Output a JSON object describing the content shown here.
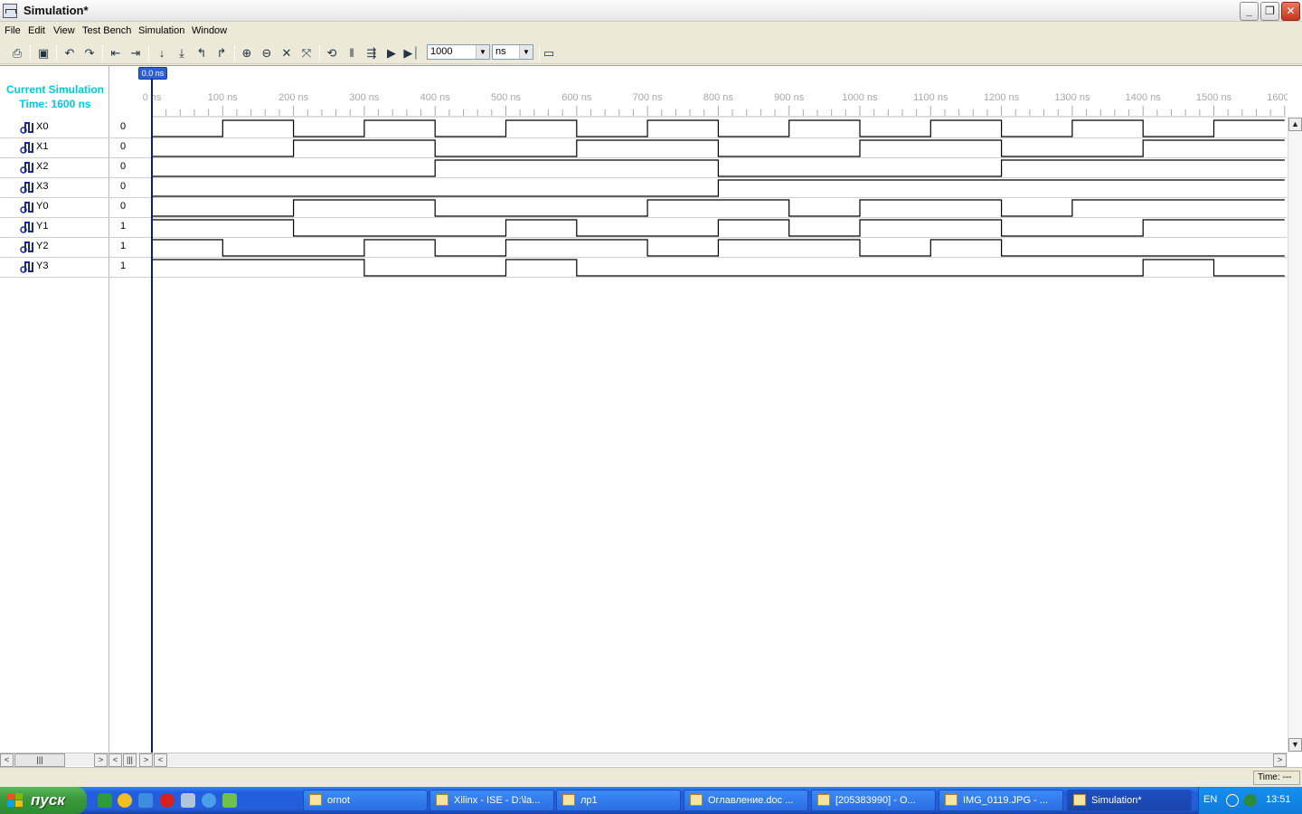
{
  "window": {
    "title": "Simulation*"
  },
  "menu": [
    "File",
    "Edit",
    "View",
    "Test Bench",
    "Simulation",
    "Window"
  ],
  "toolbar": {
    "run_length": "1000",
    "time_unit": "ns"
  },
  "simulation": {
    "label_line1": "Current Simulation",
    "label_line2": "Time: 1600 ns",
    "cursor": "0.0 ns",
    "time_axis": [
      "0 ns",
      "100 ns",
      "200 ns",
      "300 ns",
      "400 ns",
      "500 ns",
      "600 ns",
      "700 ns",
      "800 ns",
      "900 ns",
      "1000 ns",
      "1100 ns",
      "1200 ns",
      "1300 ns",
      "1400 ns",
      "1500 ns",
      "1600 ns"
    ],
    "time_range_ns": [
      0,
      1600
    ],
    "signals": [
      {
        "name": "X0",
        "value": "0",
        "wave": [
          0,
          1,
          0,
          1,
          0,
          1,
          0,
          1,
          0,
          1,
          0,
          1,
          0,
          1,
          0,
          1
        ]
      },
      {
        "name": "X1",
        "value": "0",
        "wave": [
          0,
          0,
          1,
          1,
          0,
          0,
          1,
          1,
          0,
          0,
          1,
          1,
          0,
          0,
          1,
          1
        ]
      },
      {
        "name": "X2",
        "value": "0",
        "wave": [
          0,
          0,
          0,
          0,
          1,
          1,
          1,
          1,
          0,
          0,
          0,
          0,
          1,
          1,
          1,
          1
        ]
      },
      {
        "name": "X3",
        "value": "0",
        "wave": [
          0,
          0,
          0,
          0,
          0,
          0,
          0,
          0,
          1,
          1,
          1,
          1,
          1,
          1,
          1,
          1
        ]
      },
      {
        "name": "Y0",
        "value": "0",
        "wave": [
          0,
          0,
          1,
          1,
          0,
          0,
          0,
          1,
          1,
          0,
          1,
          1,
          0,
          1,
          1,
          1
        ]
      },
      {
        "name": "Y1",
        "value": "1",
        "wave": [
          1,
          1,
          0,
          0,
          0,
          1,
          0,
          0,
          1,
          0,
          1,
          1,
          0,
          0,
          1,
          1
        ]
      },
      {
        "name": "Y2",
        "value": "1",
        "wave": [
          1,
          0,
          0,
          1,
          0,
          1,
          1,
          0,
          1,
          1,
          0,
          1,
          0,
          0,
          0,
          0
        ]
      },
      {
        "name": "Y3",
        "value": "1",
        "wave": [
          1,
          1,
          1,
          0,
          0,
          1,
          0,
          0,
          0,
          0,
          0,
          0,
          0,
          0,
          1,
          0
        ]
      }
    ]
  },
  "status": {
    "time": "Time: ---"
  },
  "taskbar": {
    "start": "пуск",
    "tasks": [
      {
        "label": "ornot",
        "active": false
      },
      {
        "label": "Xilinx - ISE - D:\\la...",
        "active": false
      },
      {
        "label": "лр1",
        "active": false
      },
      {
        "label": "Оглавление.doc ...",
        "active": false
      },
      {
        "label": "[205383990] - О...",
        "active": false
      },
      {
        "label": "IMG_0119.JPG - ...",
        "active": false
      },
      {
        "label": "Simulation*",
        "active": true
      }
    ],
    "lang": "EN",
    "clock": "13:51"
  },
  "colors": {
    "cursor": "#2f5fd0",
    "sim_label": "#00c8e6",
    "taskbar": "#245edb",
    "start": "#3c9a3c"
  }
}
